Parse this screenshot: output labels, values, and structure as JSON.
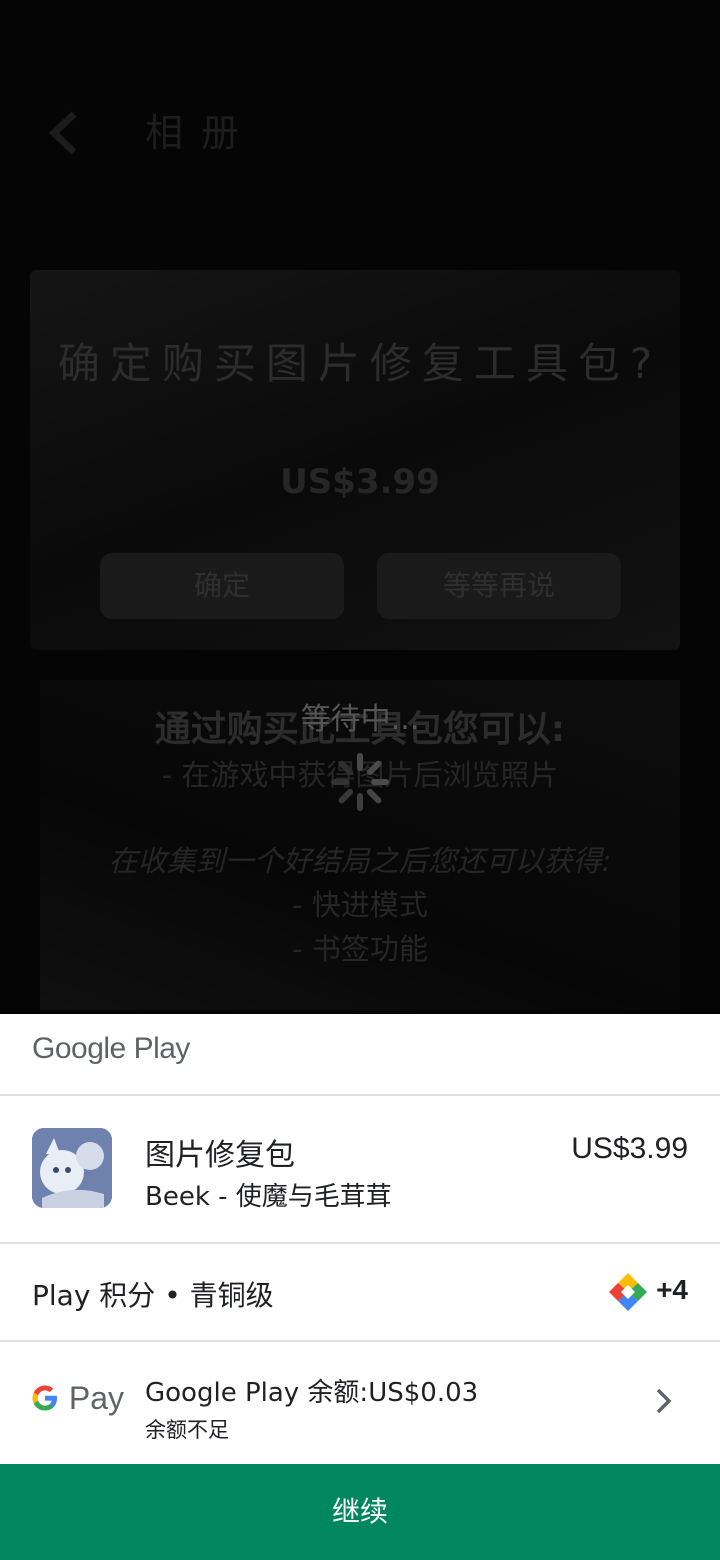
{
  "game": {
    "back_icon": "chevron-left-icon",
    "title": "相册",
    "confirm_title": "确定购买图片修复工具包?",
    "price": "US$3.99",
    "confirm_button": "确定",
    "later_button": "等等再说",
    "benefits_heading": "通过购买此工具包您可以:",
    "benefit_1": "- 在游戏中获得图片后浏览照片",
    "benefit_note": "在收集到一个好结局之后您还可以获得:",
    "benefit_2": "- 快进模式",
    "benefit_3": "- 书签功能",
    "waiting_text": "等待中..."
  },
  "sheet": {
    "header": "Google Play",
    "item": {
      "title": "图片修复包",
      "subtitle": "Beek - 使魔与毛茸茸",
      "price": "US$3.99"
    },
    "points": {
      "label": "Play 积分 • 青铜级",
      "value": "+4",
      "icon": "play-points-diamond-icon"
    },
    "payment": {
      "logo": "Pay",
      "method": "Google Play 余额:US$0.03",
      "status": "余额不足",
      "chevron": "chevron-right-icon"
    },
    "continue_label": "继续",
    "colors": {
      "primary": "#01875f",
      "text": "#202124"
    }
  }
}
